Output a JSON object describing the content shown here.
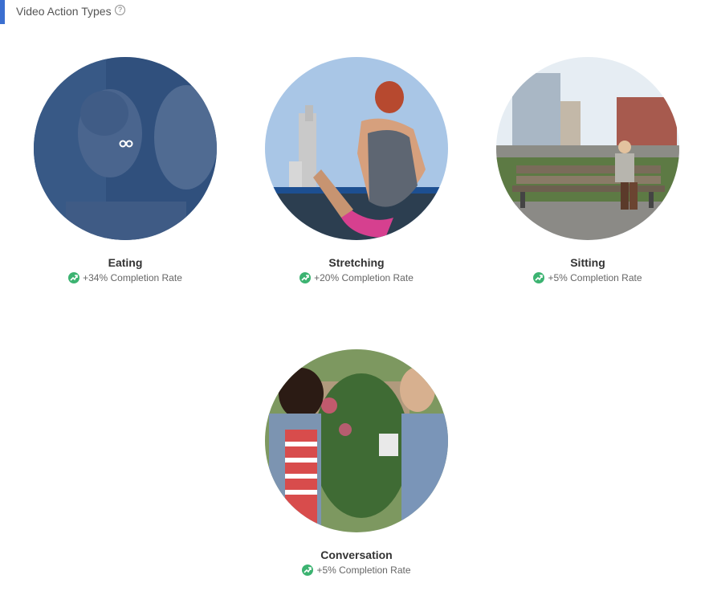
{
  "header": {
    "title": "Video Action Types",
    "help_glyph": "?"
  },
  "cards": [
    {
      "label": "Eating",
      "rate": "+34% Completion Rate",
      "selected": true,
      "icon": "trend-up-icon"
    },
    {
      "label": "Stretching",
      "rate": "+20% Completion Rate",
      "selected": false,
      "icon": "trend-up-icon"
    },
    {
      "label": "Sitting",
      "rate": "+5% Completion Rate",
      "selected": false,
      "icon": "trend-up-icon"
    },
    {
      "label": "Conversation",
      "rate": "+5% Completion Rate",
      "selected": false,
      "icon": "trend-up-icon"
    }
  ],
  "colors": {
    "accent": "#3b6fd0",
    "positive": "#3cb371",
    "overlay": "#1f3f72"
  }
}
